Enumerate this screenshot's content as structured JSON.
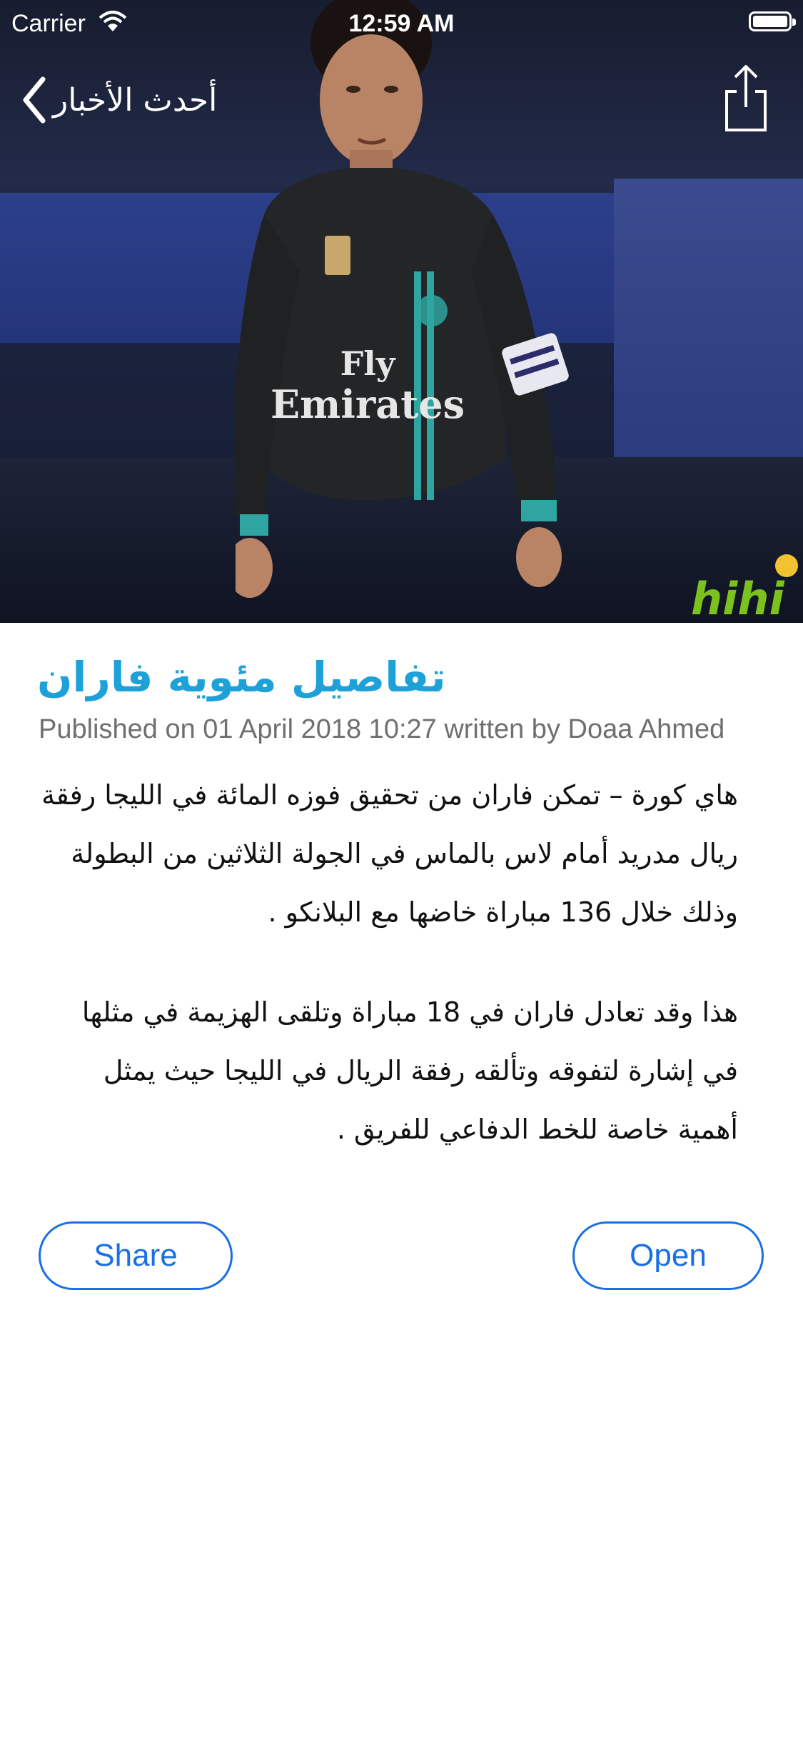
{
  "status_bar": {
    "carrier": "Carrier",
    "time": "12:59 AM"
  },
  "nav": {
    "back_label": "أحدث الأخبار",
    "back_icon": "chevron-left-icon",
    "share_icon": "share-icon"
  },
  "hero": {
    "shirt_sponsor_line1": "Fly",
    "shirt_sponsor_line2": "Emirates",
    "watermark": "hihi"
  },
  "article": {
    "title": "تفاصيل مئوية فاران",
    "published": "Published on 01 April 2018 10:27 written by Doaa Ahmed",
    "paragraphs": [
      "هاي كورة – تمكن فاران من تحقيق فوزه المائة في الليجا رفقة ريال مدريد أمام لاس بالماس في الجولة الثلاثين من البطولة وذلك خلال 136 مباراة خاضها مع البلانكو .",
      "هذا وقد تعادل فاران في 18 مباراة وتلقى الهزيمة في مثلها في إشارة لتفوقه وتألقه رفقة الريال في الليجا حيث يمثل أهمية خاصة للخط الدفاعي للفريق ."
    ]
  },
  "buttons": {
    "share": "Share",
    "open": "Open"
  },
  "colors": {
    "title": "#1da1d8",
    "accent": "#1a6fe5",
    "meta": "#6f6f6f"
  }
}
